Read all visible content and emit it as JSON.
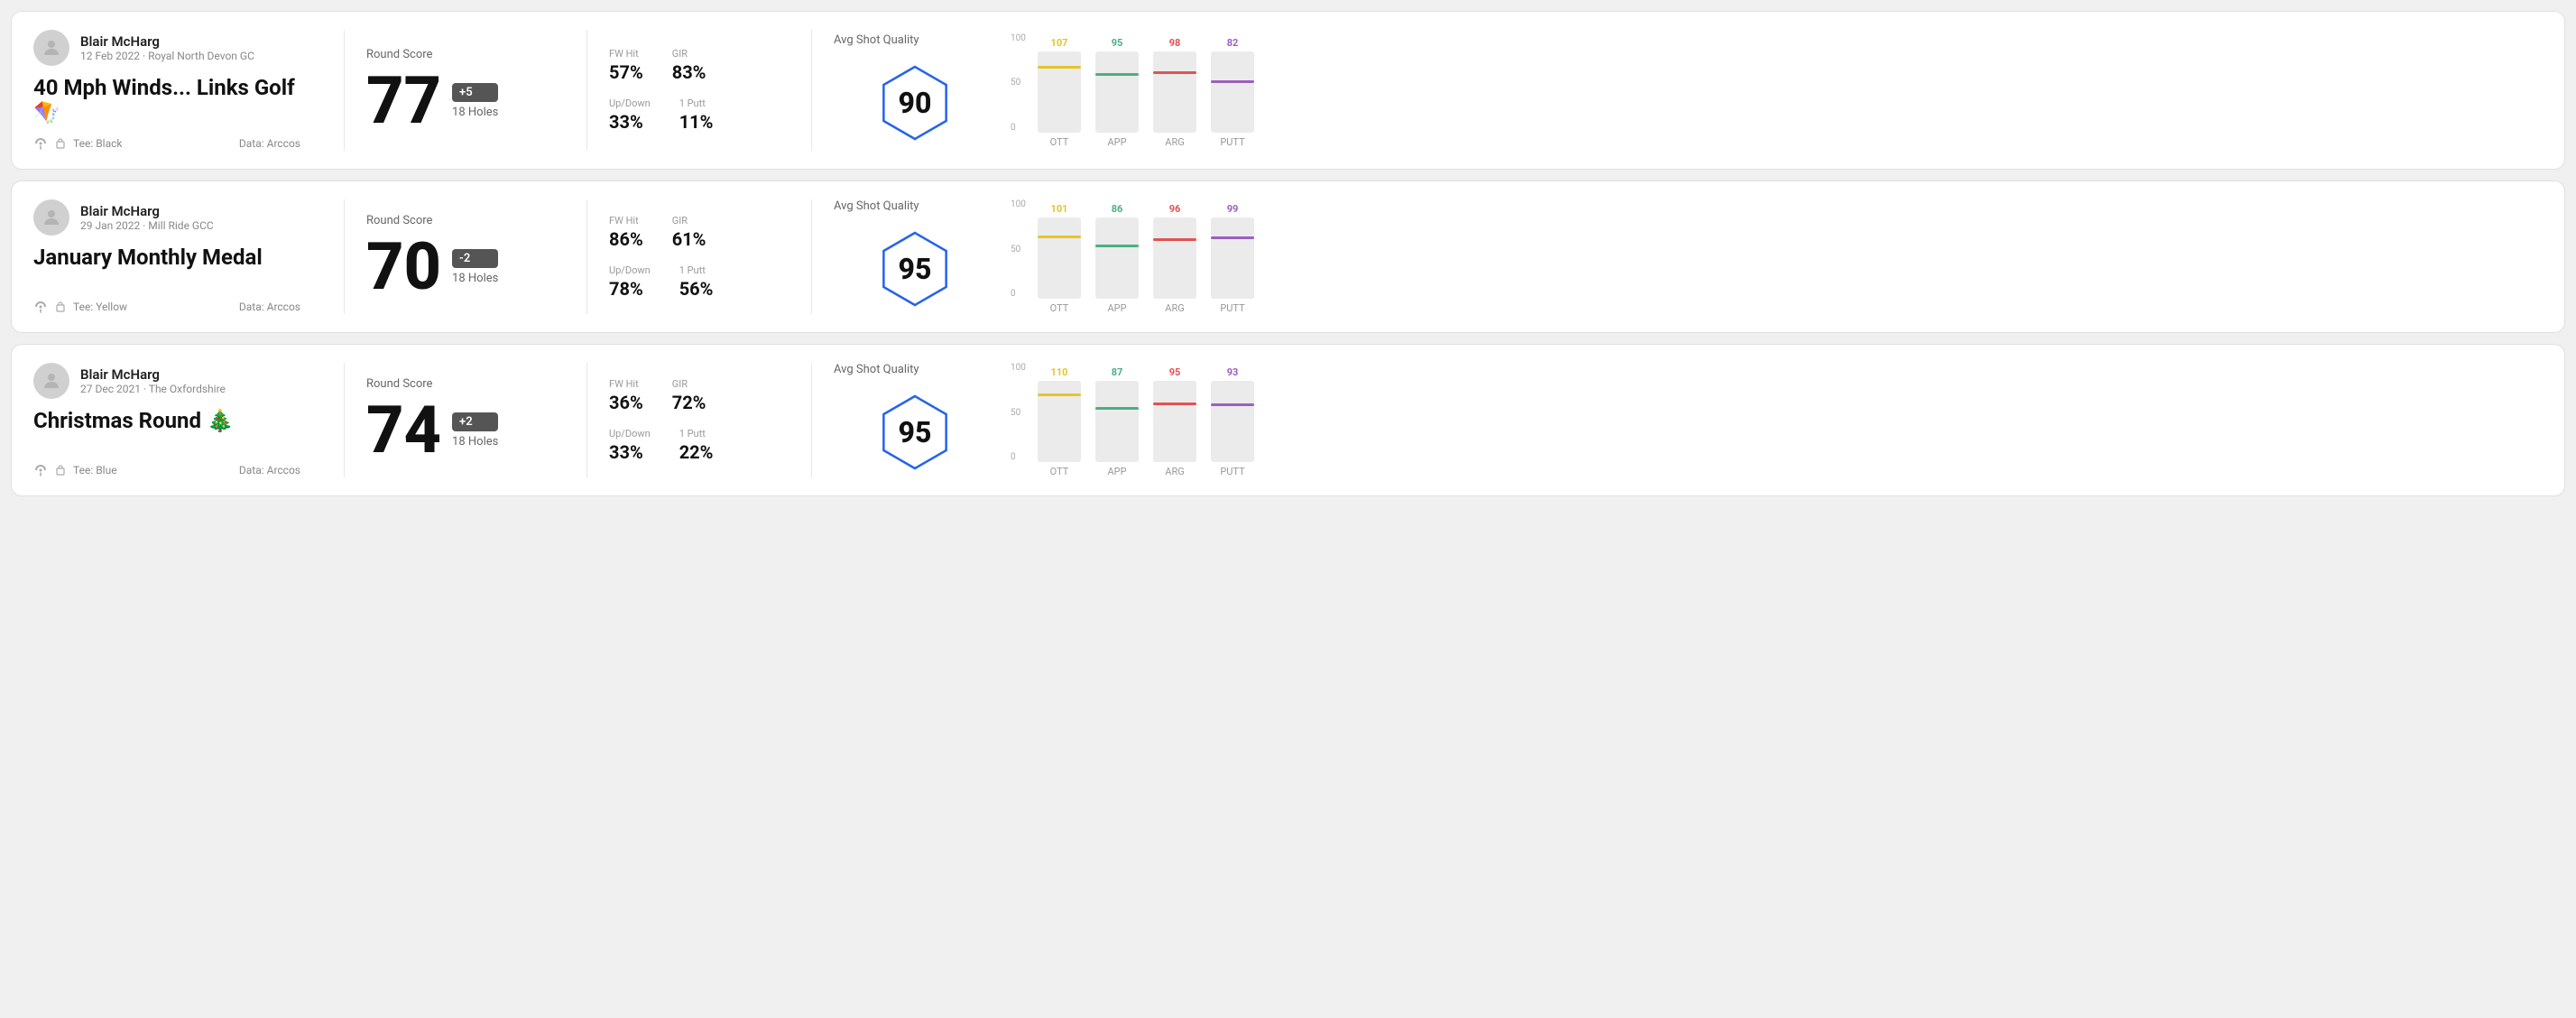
{
  "rounds": [
    {
      "id": "round1",
      "user_name": "Blair McHarg",
      "date_course": "12 Feb 2022 · Royal North Devon GC",
      "title": "40 Mph Winds... Links Golf 🪁",
      "tee": "Black",
      "data_source": "Data: Arccos",
      "score": "77",
      "score_diff": "+5",
      "score_diff_type": "positive",
      "holes": "18 Holes",
      "fw_hit_label": "FW Hit",
      "fw_hit_value": "57%",
      "gir_label": "GIR",
      "gir_value": "83%",
      "updown_label": "Up/Down",
      "updown_value": "33%",
      "oneputt_label": "1 Putt",
      "oneputt_value": "11%",
      "avg_shot_quality_label": "Avg Shot Quality",
      "avg_quality_score": "90",
      "chart_bars": [
        {
          "label": "OTT",
          "value": 107,
          "color": "#e6c42a",
          "max": 120
        },
        {
          "label": "APP",
          "value": 95,
          "color": "#4caf82",
          "max": 120
        },
        {
          "label": "ARG",
          "value": 98,
          "color": "#e05353",
          "max": 120
        },
        {
          "label": "PUTT",
          "value": 82,
          "color": "#9c5fbf",
          "max": 120
        }
      ]
    },
    {
      "id": "round2",
      "user_name": "Blair McHarg",
      "date_course": "29 Jan 2022 · Mill Ride GCC",
      "title": "January Monthly Medal",
      "tee": "Yellow",
      "data_source": "Data: Arccos",
      "score": "70",
      "score_diff": "-2",
      "score_diff_type": "negative",
      "holes": "18 Holes",
      "fw_hit_label": "FW Hit",
      "fw_hit_value": "86%",
      "gir_label": "GIR",
      "gir_value": "61%",
      "updown_label": "Up/Down",
      "updown_value": "78%",
      "oneputt_label": "1 Putt",
      "oneputt_value": "56%",
      "avg_shot_quality_label": "Avg Shot Quality",
      "avg_quality_score": "95",
      "chart_bars": [
        {
          "label": "OTT",
          "value": 101,
          "color": "#e6c42a",
          "max": 120
        },
        {
          "label": "APP",
          "value": 86,
          "color": "#4caf82",
          "max": 120
        },
        {
          "label": "ARG",
          "value": 96,
          "color": "#e05353",
          "max": 120
        },
        {
          "label": "PUTT",
          "value": 99,
          "color": "#9c5fbf",
          "max": 120
        }
      ]
    },
    {
      "id": "round3",
      "user_name": "Blair McHarg",
      "date_course": "27 Dec 2021 · The Oxfordshire",
      "title": "Christmas Round 🎄",
      "tee": "Blue",
      "data_source": "Data: Arccos",
      "score": "74",
      "score_diff": "+2",
      "score_diff_type": "positive",
      "holes": "18 Holes",
      "fw_hit_label": "FW Hit",
      "fw_hit_value": "36%",
      "gir_label": "GIR",
      "gir_value": "72%",
      "updown_label": "Up/Down",
      "updown_value": "33%",
      "oneputt_label": "1 Putt",
      "oneputt_value": "22%",
      "avg_shot_quality_label": "Avg Shot Quality",
      "avg_quality_score": "95",
      "chart_bars": [
        {
          "label": "OTT",
          "value": 110,
          "color": "#e6c42a",
          "max": 120
        },
        {
          "label": "APP",
          "value": 87,
          "color": "#4caf82",
          "max": 120
        },
        {
          "label": "ARG",
          "value": 95,
          "color": "#e05353",
          "max": 120
        },
        {
          "label": "PUTT",
          "value": 93,
          "color": "#9c5fbf",
          "max": 120
        }
      ]
    }
  ],
  "y_axis_labels": [
    "100",
    "50",
    "0"
  ]
}
